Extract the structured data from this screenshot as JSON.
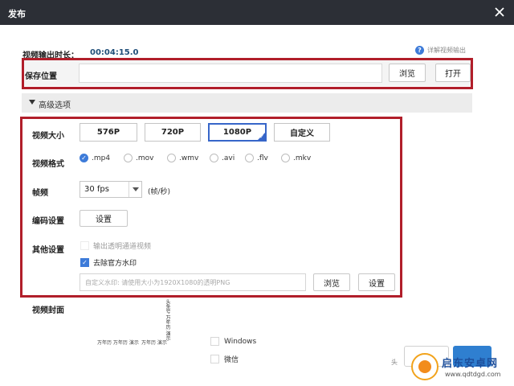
{
  "window": {
    "title": "发布",
    "close_icon": "close-icon"
  },
  "duration": {
    "label": "视频输出时长：",
    "value": "00:04:15.0"
  },
  "help": {
    "icon": "help-circle-icon",
    "text": "详解视频输出"
  },
  "save": {
    "label": "保存位置",
    "path_value": "",
    "browse_label": "浏览",
    "open_label": "打开"
  },
  "advanced": {
    "label": "高级选项",
    "icon": "triangle-down-icon"
  },
  "video_size": {
    "label": "视频大小",
    "options": [
      "576P",
      "720P",
      "1080P",
      "自定义"
    ],
    "selected": "1080P"
  },
  "video_format": {
    "label": "视频格式",
    "options": [
      ".mp4",
      ".mov",
      ".wmv",
      ".avi",
      ".flv",
      ".mkv"
    ],
    "selected": ".mp4"
  },
  "frame_rate": {
    "label": "帧频",
    "value": "30 fps",
    "unit": "(帧/秒)"
  },
  "encoding": {
    "label": "编码设置",
    "button_label": "设置"
  },
  "other": {
    "label": "其他设置",
    "transparent_channel": {
      "label": "输出透明通道视频",
      "checked": false,
      "enabled": false
    },
    "remove_watermark": {
      "label": "去除官方水印",
      "checked": true
    },
    "watermark_input_placeholder": "自定义水印: 请使用大小为1920X1080的透明PNG",
    "browse_label": "浏览",
    "settings_label": "设置"
  },
  "cover": {
    "label": "视频封面",
    "caption_left": "万年历 万年历 演示",
    "caption_right": "万年历 演示",
    "vertical_text": "头条号 万年历 演示"
  },
  "platforms": [
    {
      "label": "Windows",
      "checked": false
    },
    {
      "label": "微信",
      "checked": false
    }
  ],
  "footer_watermark": {
    "name": "启东安卓网",
    "url": "www.qdtdgd.com",
    "mark": "头"
  },
  "colors": {
    "title_bar": "#2c2f36",
    "accent_blue": "#3766c9",
    "highlight_red": "#b11e2a"
  }
}
